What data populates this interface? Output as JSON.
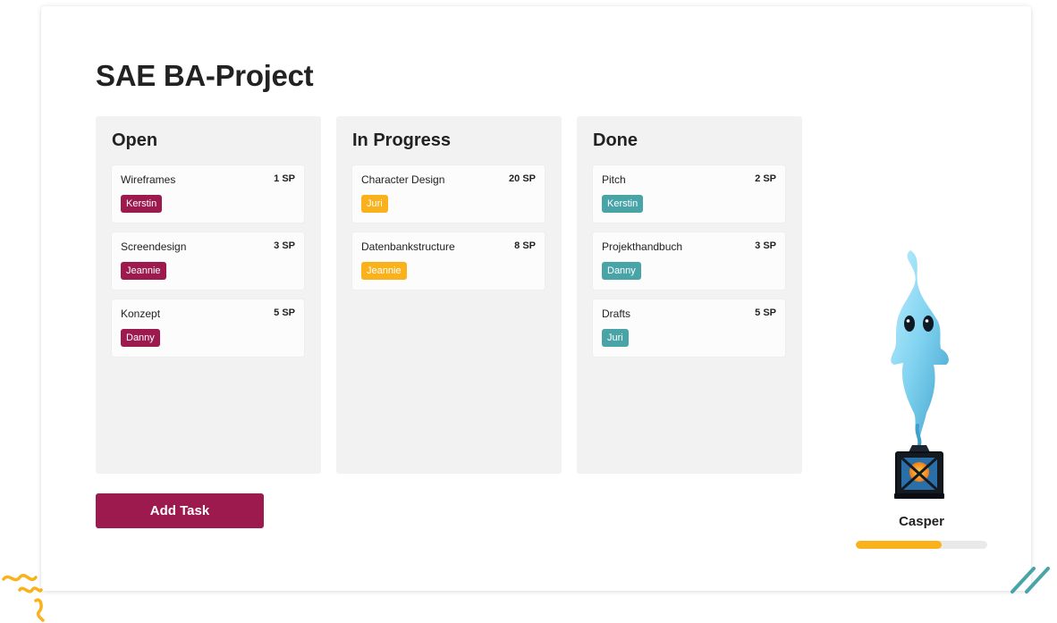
{
  "project": {
    "title": "SAE BA-Project"
  },
  "colors": {
    "open_tag": "#9c1a4d",
    "progress_tag": "#f9b21c",
    "done_tag": "#49a4a8",
    "primary_button": "#9c1a4d",
    "progress_fill": "#f9b21c"
  },
  "columns": [
    {
      "title": "Open",
      "tasks": [
        {
          "name": "Wireframes",
          "points": "1 SP",
          "assignee": "Kerstin"
        },
        {
          "name": "Screendesign",
          "points": "3 SP",
          "assignee": "Jeannie"
        },
        {
          "name": "Konzept",
          "points": "5 SP",
          "assignee": "Danny"
        }
      ]
    },
    {
      "title": "In Progress",
      "tasks": [
        {
          "name": "Character Design",
          "points": "20 SP",
          "assignee": "Juri"
        },
        {
          "name": "Datenbankstructure",
          "points": "8 SP",
          "assignee": "Jeannie"
        }
      ]
    },
    {
      "title": "Done",
      "tasks": [
        {
          "name": "Pitch",
          "points": "2 SP",
          "assignee": "Kerstin"
        },
        {
          "name": "Projekthandbuch",
          "points": "3 SP",
          "assignee": "Danny"
        },
        {
          "name": "Drafts",
          "points": "5 SP",
          "assignee": "Juri"
        }
      ]
    }
  ],
  "actions": {
    "add_task_label": "Add Task"
  },
  "mascot": {
    "name": "Casper",
    "icon": "ghost-lantern-icon",
    "progress_fraction": 0.65
  }
}
